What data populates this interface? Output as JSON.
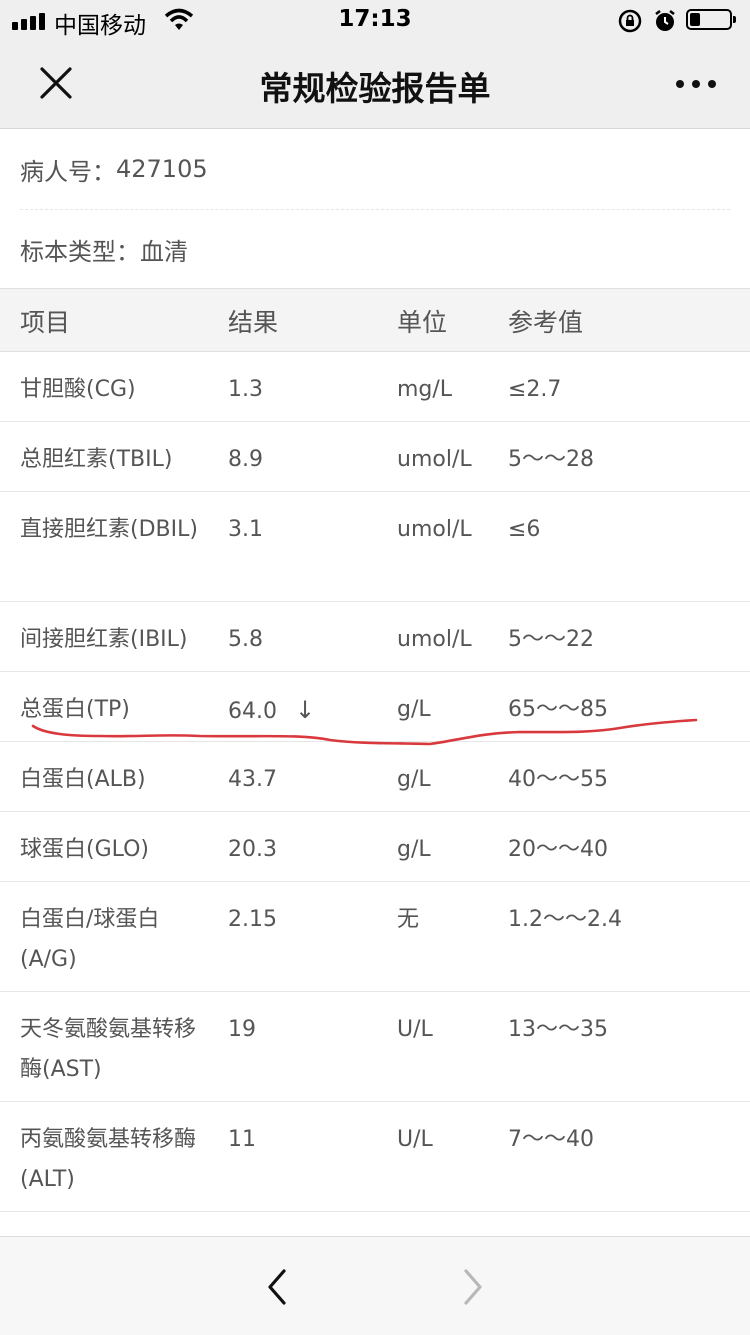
{
  "status_bar": {
    "carrier": "中国移动",
    "time": "17:13",
    "battery_level": 0.2
  },
  "nav": {
    "title": "常规检验报告单",
    "close_icon": "close-icon",
    "more_icon": "more-icon"
  },
  "info": {
    "patient_label": "病人号：",
    "patient_id": "427105",
    "specimen_label": "标本类型：",
    "specimen_type": "血清"
  },
  "table": {
    "headers": [
      "项目",
      "结果",
      "单位",
      "参考值"
    ],
    "rows": [
      {
        "item": "甘胆酸(CG)",
        "result": "1.3",
        "unit": "mg/L",
        "reference": "≤2.7"
      },
      {
        "item": "总胆红素(TBIL)",
        "result": "8.9",
        "unit": "umol/L",
        "reference": "5～～28"
      },
      {
        "item": "直接胆红素(DBIL)",
        "result": "3.1",
        "unit": "umol/L",
        "reference": "≤6"
      },
      {
        "item": "间接胆红素(IBIL)",
        "result": "5.8",
        "unit": "umol/L",
        "reference": "5～～22"
      },
      {
        "item": "总蛋白(TP)",
        "result": "64.0",
        "flag": "↓",
        "unit": "g/L",
        "reference": "65～～85"
      },
      {
        "item": "白蛋白(ALB)",
        "result": "43.7",
        "unit": "g/L",
        "reference": "40～～55"
      },
      {
        "item": "球蛋白(GLO)",
        "result": "20.3",
        "unit": "g/L",
        "reference": "20～～40"
      },
      {
        "item": "白蛋白/球蛋白(A/G)",
        "result": "2.15",
        "unit": "无",
        "reference": "1.2～～2.4"
      },
      {
        "item": "天冬氨酸氨基转移酶(AST)",
        "result": "19",
        "unit": "U/L",
        "reference": "13～～35"
      },
      {
        "item": "丙氨酸氨基转移酶(ALT)",
        "result": "11",
        "unit": "U/L",
        "reference": "7～～40"
      }
    ]
  },
  "toolbar": {
    "back_icon": "chevron-left-icon",
    "forward_icon": "chevron-right-icon"
  },
  "colors": {
    "nav_bg": "#efefef",
    "annotation_red": "#d9393d",
    "text": "#555555"
  }
}
